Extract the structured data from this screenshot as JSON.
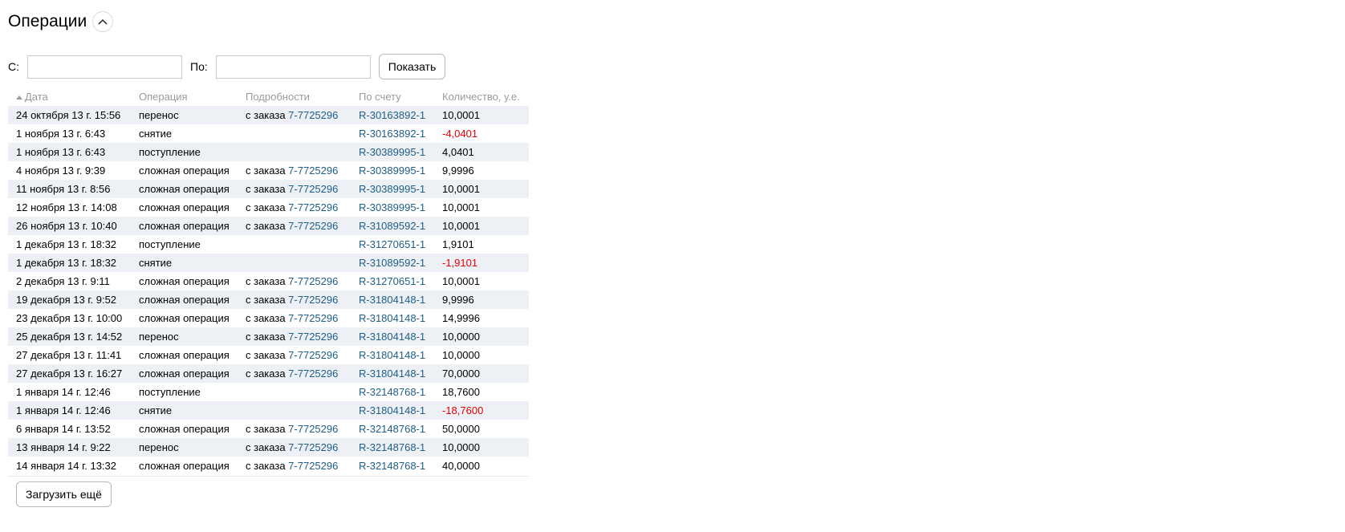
{
  "section": {
    "title": "Операции",
    "collapse_icon": "chevron-up-icon"
  },
  "filters": {
    "from_label": "С:",
    "from_value": "",
    "to_label": "По:",
    "to_value": "",
    "show_button": "Показать"
  },
  "table": {
    "sort_icon": "sort-ascending-icon",
    "headers": {
      "date": "Дата",
      "operation": "Операция",
      "details": "Подробности",
      "account": "По счету",
      "amount": "Количество, у.е."
    },
    "rows": [
      {
        "date": "24 октября 13 г. 15:56",
        "operation": "перенос",
        "details_prefix": "с заказа ",
        "details_link": "7-7725296",
        "account": "R-30163892-1",
        "amount": "10,0001",
        "negative": false
      },
      {
        "date": "1 ноября 13 г. 6:43",
        "operation": "снятие",
        "details_prefix": "",
        "details_link": "",
        "account": "R-30163892-1",
        "amount": "-4,0401",
        "negative": true
      },
      {
        "date": "1 ноября 13 г. 6:43",
        "operation": "поступление",
        "details_prefix": "",
        "details_link": "",
        "account": "R-30389995-1",
        "amount": "4,0401",
        "negative": false
      },
      {
        "date": "4 ноября 13 г. 9:39",
        "operation": "сложная операция",
        "details_prefix": "с заказа ",
        "details_link": "7-7725296",
        "account": "R-30389995-1",
        "amount": "9,9996",
        "negative": false
      },
      {
        "date": "11 ноября 13 г. 8:56",
        "operation": "сложная операция",
        "details_prefix": "с заказа ",
        "details_link": "7-7725296",
        "account": "R-30389995-1",
        "amount": "10,0001",
        "negative": false
      },
      {
        "date": "12 ноября 13 г. 14:08",
        "operation": "сложная операция",
        "details_prefix": "с заказа ",
        "details_link": "7-7725296",
        "account": "R-30389995-1",
        "amount": "10,0001",
        "negative": false
      },
      {
        "date": "26 ноября 13 г. 10:40",
        "operation": "сложная операция",
        "details_prefix": "с заказа ",
        "details_link": "7-7725296",
        "account": "R-31089592-1",
        "amount": "10,0001",
        "negative": false
      },
      {
        "date": "1 декабря 13 г. 18:32",
        "operation": "поступление",
        "details_prefix": "",
        "details_link": "",
        "account": "R-31270651-1",
        "amount": "1,9101",
        "negative": false
      },
      {
        "date": "1 декабря 13 г. 18:32",
        "operation": "снятие",
        "details_prefix": "",
        "details_link": "",
        "account": "R-31089592-1",
        "amount": "-1,9101",
        "negative": true
      },
      {
        "date": "2 декабря 13 г. 9:11",
        "operation": "сложная операция",
        "details_prefix": "с заказа ",
        "details_link": "7-7725296",
        "account": "R-31270651-1",
        "amount": "10,0001",
        "negative": false
      },
      {
        "date": "19 декабря 13 г. 9:52",
        "operation": "сложная операция",
        "details_prefix": "с заказа ",
        "details_link": "7-7725296",
        "account": "R-31804148-1",
        "amount": "9,9996",
        "negative": false
      },
      {
        "date": "23 декабря 13 г. 10:00",
        "operation": "сложная операция",
        "details_prefix": "с заказа ",
        "details_link": "7-7725296",
        "account": "R-31804148-1",
        "amount": "14,9996",
        "negative": false
      },
      {
        "date": "25 декабря 13 г. 14:52",
        "operation": "перенос",
        "details_prefix": "с заказа ",
        "details_link": "7-7725296",
        "account": "R-31804148-1",
        "amount": "10,0000",
        "negative": false
      },
      {
        "date": "27 декабря 13 г. 11:41",
        "operation": "сложная операция",
        "details_prefix": "с заказа ",
        "details_link": "7-7725296",
        "account": "R-31804148-1",
        "amount": "10,0000",
        "negative": false
      },
      {
        "date": "27 декабря 13 г. 16:27",
        "operation": "сложная операция",
        "details_prefix": "с заказа ",
        "details_link": "7-7725296",
        "account": "R-31804148-1",
        "amount": "70,0000",
        "negative": false
      },
      {
        "date": "1 января 14 г. 12:46",
        "operation": "поступление",
        "details_prefix": "",
        "details_link": "",
        "account": "R-32148768-1",
        "amount": "18,7600",
        "negative": false
      },
      {
        "date": "1 января 14 г. 12:46",
        "operation": "снятие",
        "details_prefix": "",
        "details_link": "",
        "account": "R-31804148-1",
        "amount": "-18,7600",
        "negative": true
      },
      {
        "date": "6 января 14 г. 13:52",
        "operation": "сложная операция",
        "details_prefix": "с заказа ",
        "details_link": "7-7725296",
        "account": "R-32148768-1",
        "amount": "50,0000",
        "negative": false
      },
      {
        "date": "13 января 14 г. 9:22",
        "operation": "перенос",
        "details_prefix": "с заказа ",
        "details_link": "7-7725296",
        "account": "R-32148768-1",
        "amount": "10,0000",
        "negative": false
      },
      {
        "date": "14 января 14 г. 13:32",
        "operation": "сложная операция",
        "details_prefix": "с заказа ",
        "details_link": "7-7725296",
        "account": "R-32148768-1",
        "amount": "40,0000",
        "negative": false
      }
    ]
  },
  "load_more": "Загрузить ещё",
  "colors": {
    "link": "#1f5e86",
    "negative": "#e60000",
    "stripe": "#edf0f5",
    "header_text": "#9a9a9a"
  }
}
